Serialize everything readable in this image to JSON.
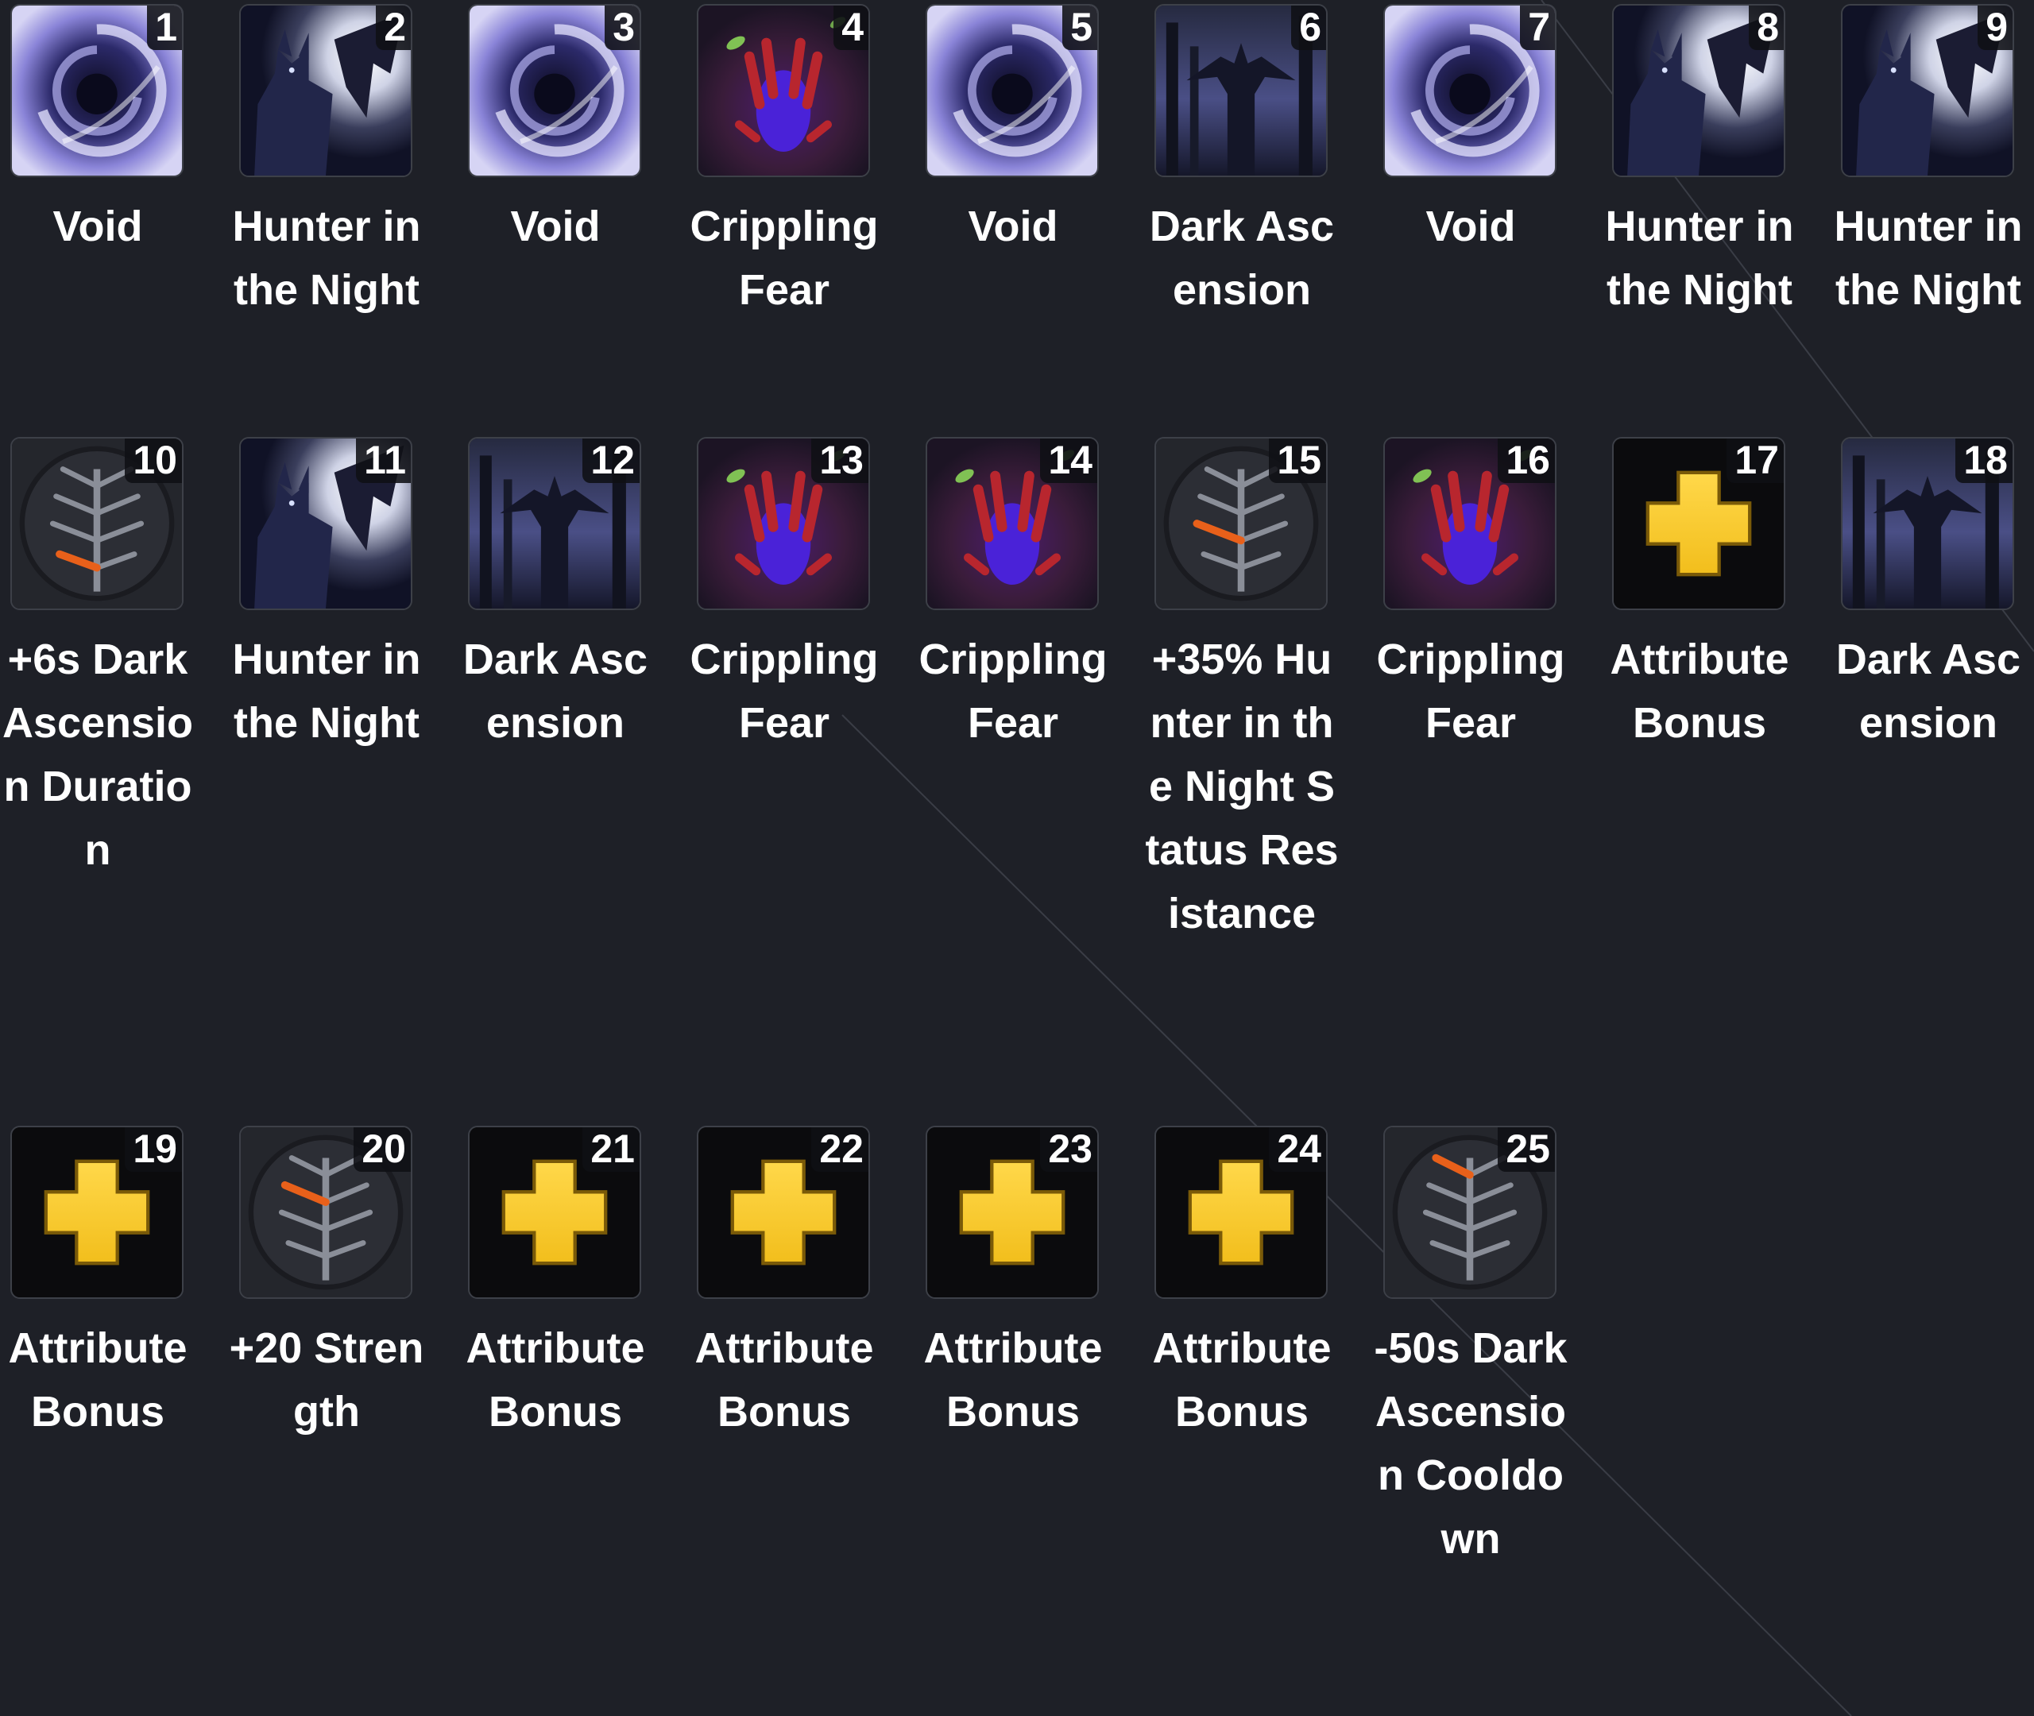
{
  "talents": [
    [
      {
        "num": "1",
        "name": "Void",
        "icon": "void-icon"
      },
      {
        "num": "2",
        "name": "Hunter in the Night",
        "icon": "hunter-in-the-night-icon"
      },
      {
        "num": "3",
        "name": "Void",
        "icon": "void-icon"
      },
      {
        "num": "4",
        "name": "Crippling Fear",
        "icon": "crippling-fear-icon"
      },
      {
        "num": "5",
        "name": "Void",
        "icon": "void-icon"
      },
      {
        "num": "6",
        "name": "Dark Ascension",
        "icon": "dark-ascension-icon"
      },
      {
        "num": "7",
        "name": "Void",
        "icon": "void-icon"
      },
      {
        "num": "8",
        "name": "Hunter in the Night",
        "icon": "hunter-in-the-night-icon"
      },
      {
        "num": "9",
        "name": "Hunter in the Night",
        "icon": "hunter-in-the-night-icon"
      }
    ],
    [
      {
        "num": "10",
        "name": "+6s Dark Ascension Duration",
        "icon": "talent-tree-icon"
      },
      {
        "num": "11",
        "name": "Hunter in the Night",
        "icon": "hunter-in-the-night-icon"
      },
      {
        "num": "12",
        "name": "Dark Ascension",
        "icon": "dark-ascension-icon"
      },
      {
        "num": "13",
        "name": "Crippling Fear",
        "icon": "crippling-fear-icon"
      },
      {
        "num": "14",
        "name": "Crippling Fear",
        "icon": "crippling-fear-icon"
      },
      {
        "num": "15",
        "name": "+35% Hunter in the Night Status Resistance",
        "icon": "talent-tree-icon"
      },
      {
        "num": "16",
        "name": "Crippling Fear",
        "icon": "crippling-fear-icon"
      },
      {
        "num": "17",
        "name": "Attribute Bonus",
        "icon": "attribute-bonus-icon"
      },
      {
        "num": "18",
        "name": "Dark Ascension",
        "icon": "dark-ascension-icon"
      }
    ],
    [
      {
        "num": "19",
        "name": "Attribute Bonus",
        "icon": "attribute-bonus-icon"
      },
      {
        "num": "20",
        "name": "+20 Strength",
        "icon": "talent-tree-icon"
      },
      {
        "num": "21",
        "name": "Attribute Bonus",
        "icon": "attribute-bonus-icon"
      },
      {
        "num": "22",
        "name": "Attribute Bonus",
        "icon": "attribute-bonus-icon"
      },
      {
        "num": "23",
        "name": "Attribute Bonus",
        "icon": "attribute-bonus-icon"
      },
      {
        "num": "24",
        "name": "Attribute Bonus",
        "icon": "attribute-bonus-icon"
      },
      {
        "num": "25",
        "name": "-50s Dark Ascension Cooldown",
        "icon": "talent-tree-icon"
      }
    ]
  ],
  "colors": {
    "background": "#1e2027",
    "text": "#ffffff",
    "attribute_plus": "#f2be1c",
    "talent_highlight": "#e8601a",
    "void_swirl": "#8a84d8"
  }
}
